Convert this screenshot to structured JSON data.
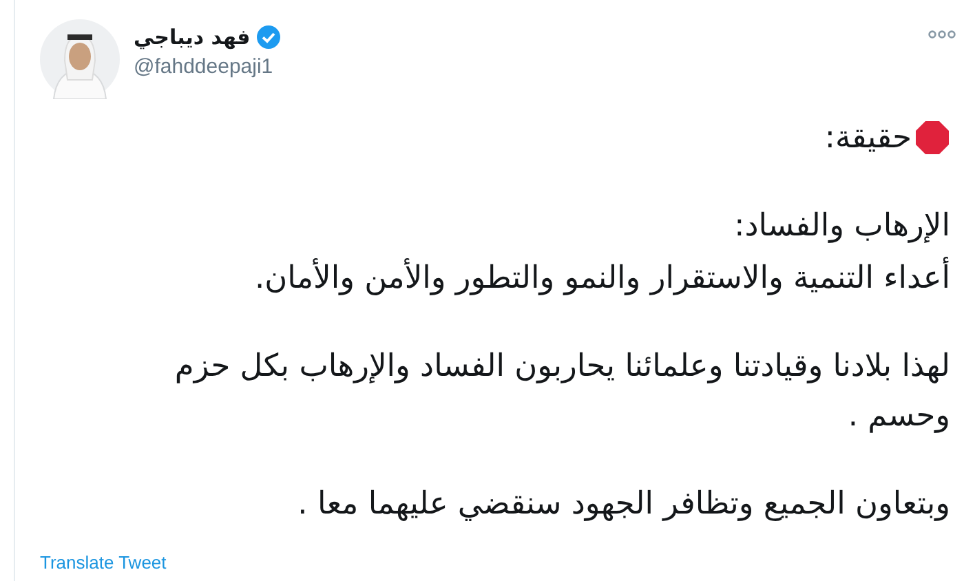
{
  "author": {
    "name": "فهد ديباجي",
    "handle": "@fahddeepaji1",
    "verified": true
  },
  "paragraphs": [
    {
      "lines": [
        "حقيقة:"
      ],
      "stop_sign": true
    },
    {
      "lines": [
        "الإرهاب والفساد:",
        "أعداء التنمية والاستقرار والنمو والتطور والأمن والأمان."
      ],
      "stop_sign": false
    },
    {
      "lines": [
        "لهذا بلادنا وقيادتنا وعلمائنا يحاربون الفساد والإرهاب بكل حزم وحسم ."
      ],
      "stop_sign": false
    },
    {
      "lines": [
        "وبتعاون الجميع وتظافر الجهود سنقضي عليهما معا ."
      ],
      "stop_sign": false
    }
  ],
  "translate_link": "Translate Tweet"
}
